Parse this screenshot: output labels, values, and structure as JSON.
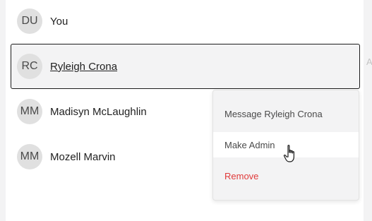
{
  "members": [
    {
      "initials": "DU",
      "name": "You"
    },
    {
      "initials": "RC",
      "name": "Ryleigh Crona"
    },
    {
      "initials": "MM",
      "name": "Madisyn McLaughlin"
    },
    {
      "initials": "MM",
      "name": "Mozell Marvin"
    }
  ],
  "edge_text": "A",
  "menu": {
    "items": [
      {
        "label": "Message Ryleigh Crona"
      },
      {
        "label": "Make Admin"
      },
      {
        "label": "Remove"
      }
    ]
  },
  "colors": {
    "danger": "#e03a3a",
    "selected_border": "#1c1c1c",
    "avatar_bg": "#e0e0e0"
  },
  "cursor_icon": "hand-pointer-icon"
}
